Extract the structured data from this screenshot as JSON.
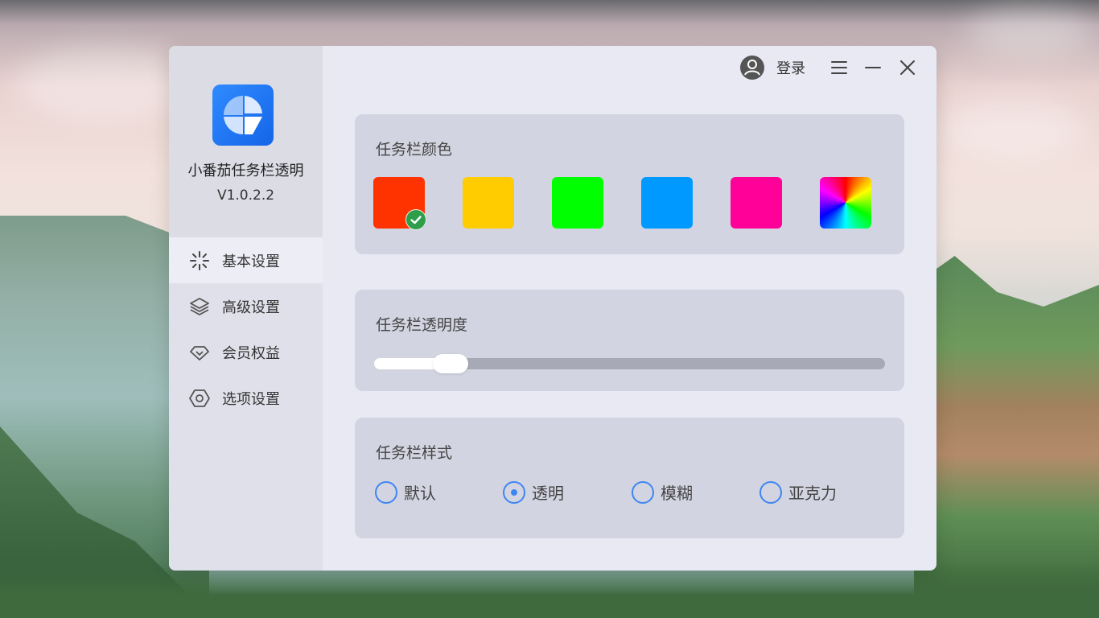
{
  "app": {
    "name": "小番茄任务栏透明",
    "version": "V1.0.2.2"
  },
  "topbar": {
    "login_label": "登录"
  },
  "nav": [
    {
      "label": "基本设置",
      "icon": "sparkle-icon",
      "active": true
    },
    {
      "label": "高级设置",
      "icon": "layers-icon",
      "active": false
    },
    {
      "label": "会员权益",
      "icon": "diamond-icon",
      "active": false
    },
    {
      "label": "选项设置",
      "icon": "hexagon-settings-icon",
      "active": false
    }
  ],
  "color_card": {
    "title": "任务栏颜色",
    "selected_index": 0,
    "swatches": [
      {
        "name": "red",
        "color": "#ff3300"
      },
      {
        "name": "yellow",
        "color": "#ffcc00"
      },
      {
        "name": "green",
        "color": "#00ff00"
      },
      {
        "name": "blue",
        "color": "#0099ff"
      },
      {
        "name": "pink",
        "color": "#ff0099"
      },
      {
        "name": "rainbow",
        "color": "conic"
      }
    ]
  },
  "transparency_card": {
    "title": "任务栏透明度",
    "value": 0.15
  },
  "style_card": {
    "title": "任务栏样式",
    "selected": "透明",
    "options": [
      "默认",
      "透明",
      "模糊",
      "亚克力"
    ]
  },
  "colors": {
    "accent": "#3e86f2",
    "window_bg": "#e9e9f4",
    "sidebar_bg": "#e0e0ea",
    "card_bg": "#d3d4e1"
  }
}
